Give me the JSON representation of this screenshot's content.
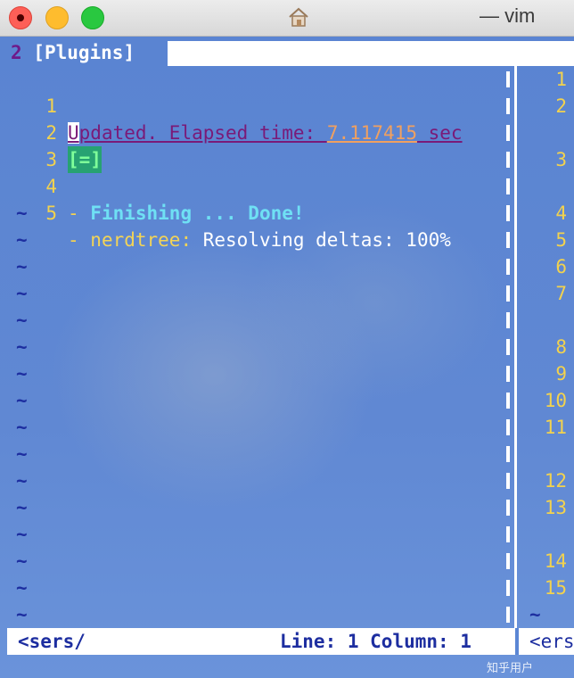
{
  "window": {
    "title": "— vim",
    "icon": "home-icon"
  },
  "tab": {
    "number": "2",
    "label": " [Plugins] "
  },
  "left_pane": {
    "lines": [
      {
        "n": "1",
        "prefix": "U",
        "updated": "pdated. Elapsed time: ",
        "time": "7.117415",
        "suffix": " sec"
      },
      {
        "n": "2",
        "bar": "[=]"
      },
      {
        "n": "3"
      },
      {
        "n": "4",
        "dash": "- ",
        "text": "Finishing ... Done!"
      },
      {
        "n": "5",
        "dash": "- ",
        "plugin": "nerdtree:",
        "status": " Resolving deltas: 100%"
      }
    ],
    "tilde": "~"
  },
  "right_pane": {
    "numbers": [
      "1",
      "2",
      "3",
      "4",
      "5",
      "6",
      "7",
      "8",
      "9",
      "10",
      "11",
      "12",
      "13",
      "14",
      "15"
    ],
    "tilde": "~"
  },
  "statusline": {
    "left": "<sers/",
    "middle": "Line: 1  Column: 1",
    "right": "<ers"
  },
  "watermark": "知乎用户",
  "colors": {
    "background": "#5b86d4",
    "line_number": "#f2d24e",
    "tilde": "#1d2ea0",
    "finishing": "#6fe0f4",
    "updated": "#7a1a78",
    "elapsed": "#f0a060"
  }
}
